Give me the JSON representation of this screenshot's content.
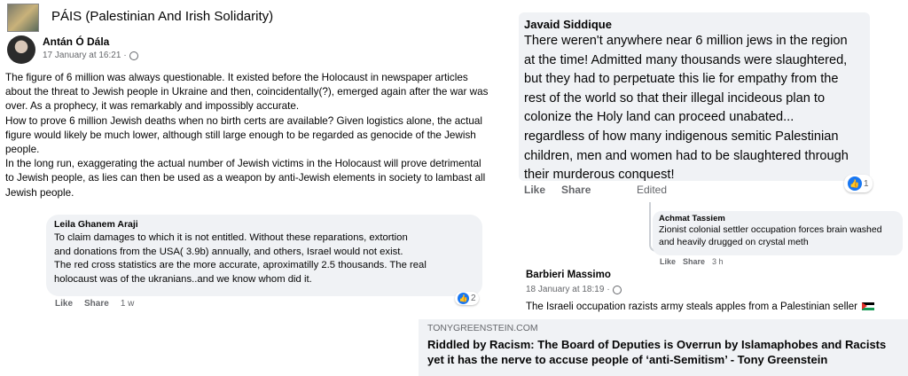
{
  "group": {
    "name": "PÁIS (Palestinian And Irish Solidarity)"
  },
  "post": {
    "author": "Antán Ó Dála",
    "date": "17 January at 16:21",
    "separator": "·",
    "paragraphs": [
      "The figure of 6 million was always questionable. It existed before the Holocaust in newspaper articles about the threat to Jewish people in Ukraine and then, coincidentally(?), emerged again after the war was over. As a prophecy, it was remarkably and impossibly accurate.",
      "How to prove 6 million Jewish deaths when no birth certs are available? Given logistics alone, the actual figure would likely be much lower, although still large enough to be regarded as genocide of the Jewish people.",
      "In the long run, exaggerating the actual number of Jewish victims in the Holocaust will prove detrimental to Jewish people, as lies can then be used as a weapon by anti-Jewish elements in society to lambast all Jewish people."
    ]
  },
  "comments": [
    {
      "author": "Leila Ghanem Araji",
      "lines": [
        "To claim damages to which it is not entitled. Without these reparations, extortion",
        "and donations from the USA( 3.9b) annually, and others, Israel would not exist.",
        "The red cross statistics are the more accurate, aproximatilly 2.5 thousands. The real",
        "holocaust was of the ukranians..and we know whom did it."
      ],
      "like_label": "Like",
      "reply_label": "Share",
      "time": "1 w",
      "reaction_count": "2"
    },
    {
      "author": "Javaid Siddique",
      "lines": [
        "There weren't anywhere near 6 million jews in the region",
        "at the time! Admitted many thousands were slaughtered,",
        "but they had to perpetuate this lie for empathy from the",
        "rest of the world so that their illegal incideous plan to",
        "colonize the Holy land can proceed unabated...",
        "regardless of how many indigenous semitic Palestinian",
        "children, men and women had to be slaughtered through",
        "their murderous conquest!"
      ],
      "like_label": "Like",
      "reply_label": "Share",
      "edited_label": "Edited",
      "reaction_count": "1"
    },
    {
      "author": "Achmat Tassiem",
      "lines": [
        "Zionist colonial settler occupation forces brain washed",
        "and heavily drugged on crystal meth"
      ],
      "like_label": "Like",
      "reply_label": "Share",
      "time": "3 h"
    },
    {
      "author": "Barbieri Massimo",
      "date": "18 January at 18:19",
      "separator": "·",
      "text": "The Israeli occupation razists  army steals apples from a Palestinian seller"
    }
  ],
  "link_preview": {
    "domain": "TONYGREENSTEIN.COM",
    "title_line1": "Riddled by Racism: The Board of Deputies is Overrun by Islamaphobes and Racists",
    "title_line2": "yet it has the nerve to accuse people of ‘anti-Semitism’ - Tony Greenstein"
  },
  "icons": {
    "globe": "globe-icon",
    "like_reaction": "like-reaction-icon",
    "flag": "palestine-flag-icon"
  },
  "colors": {
    "bubble": "#f0f2f5",
    "secondary_text": "#65676b",
    "like_blue": "#1877f2"
  }
}
